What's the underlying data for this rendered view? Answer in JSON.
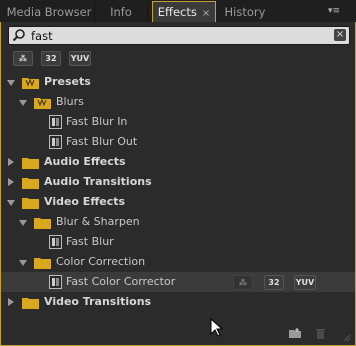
{
  "tabs": [
    {
      "label": "Media Browser"
    },
    {
      "label": "Info"
    },
    {
      "label": "Effects",
      "close": "×"
    },
    {
      "label": "History"
    }
  ],
  "panel_menu": "▾≡",
  "search": {
    "value": "fast",
    "clear": "×"
  },
  "filters": [
    {
      "label": "⁂"
    },
    {
      "label": "32"
    },
    {
      "label": "YUV"
    }
  ],
  "tree": {
    "presets": "Presets",
    "blurs": "Blurs",
    "fast_blur_in": "Fast Blur In",
    "fast_blur_out": "Fast Blur Out",
    "audio_effects": "Audio Effects",
    "audio_transitions": "Audio Transitions",
    "video_effects": "Video Effects",
    "blur_sharpen": "Blur & Sharpen",
    "fast_blur": "Fast Blur",
    "color_correction": "Color Correction",
    "fast_color_corrector": "Fast Color Corrector",
    "video_transitions": "Video Transitions"
  },
  "row_badges": [
    {
      "label": "⁂"
    },
    {
      "label": "32"
    },
    {
      "label": "YUV"
    }
  ],
  "colors": {
    "accent": "#c8a030",
    "folder": "#d8a820",
    "panel": "#2b2b2b"
  }
}
